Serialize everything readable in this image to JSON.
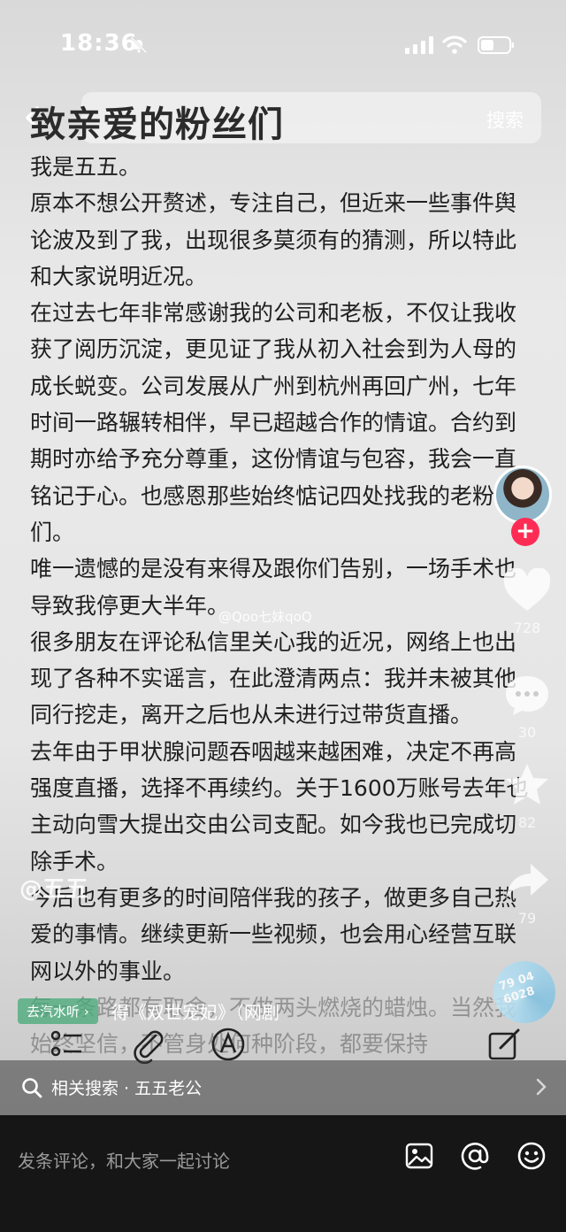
{
  "status_bar": {
    "time": "18:36"
  },
  "search": {
    "button_label": "搜索"
  },
  "article": {
    "title": "致亲爱的粉丝们",
    "paragraphs": [
      "我是五五。",
      "原本不想公开赘述，专注自己，但近来一些事件舆论波及到了我，出现很多莫须有的猜测，所以特此和大家说明近况。",
      "在过去七年非常感谢我的公司和老板，不仅让我收获了阅历沉淀，更见证了我从初入社会到为人母的成长蜕变。公司发展从广州到杭州再回广州，七年时间一路辗转相伴，早已超越合作的情谊。合约到期时亦给予充分尊重，这份情谊与包容，我会一直铭记于心。也感恩那些始终惦记四处找我的老粉们。",
      "唯一遗憾的是没有来得及跟你们告别，一场手术也导致我停更大半年。",
      "很多朋友在评论私信里关心我的近况，网络上也出现了各种不实谣言，在此澄清两点：我并未被其他同行挖走，离开之后也从未进行过带货直播。",
      "去年由于甲状腺问题吞咽越来越困难，决定不再高强度直播，选择不再续约。关于1600万账号去年也主动向雪大提出交由公司支配。如今我也已完成切除手术。",
      "今后也有更多的时间陪伴我的孩子，做更多自己热爱的事情。继续更新一些视频，也会用心经营互联网以外的事业。",
      "每一条路都有取舍，不做两头燃烧的蜡烛。当然我始终坚信，不管身处何种阶段，都要保持"
    ],
    "watermark": "@Qoo七妹qoQ"
  },
  "author": {
    "handle": "@五五"
  },
  "actions": {
    "likes": "728",
    "comments": "30",
    "favorites": "82",
    "shares": "79"
  },
  "music": {
    "chip": "去汽水听 ›",
    "title": "得《双世宠妃》（网剧",
    "disc_text": "79 04 6028"
  },
  "related": {
    "label": "相关搜索 · 五五老公"
  },
  "comment_bar": {
    "placeholder": "发条评论，和大家一起讨论"
  },
  "colors": {
    "follow": "#fe2c55",
    "bottom_bar": "#161616"
  }
}
